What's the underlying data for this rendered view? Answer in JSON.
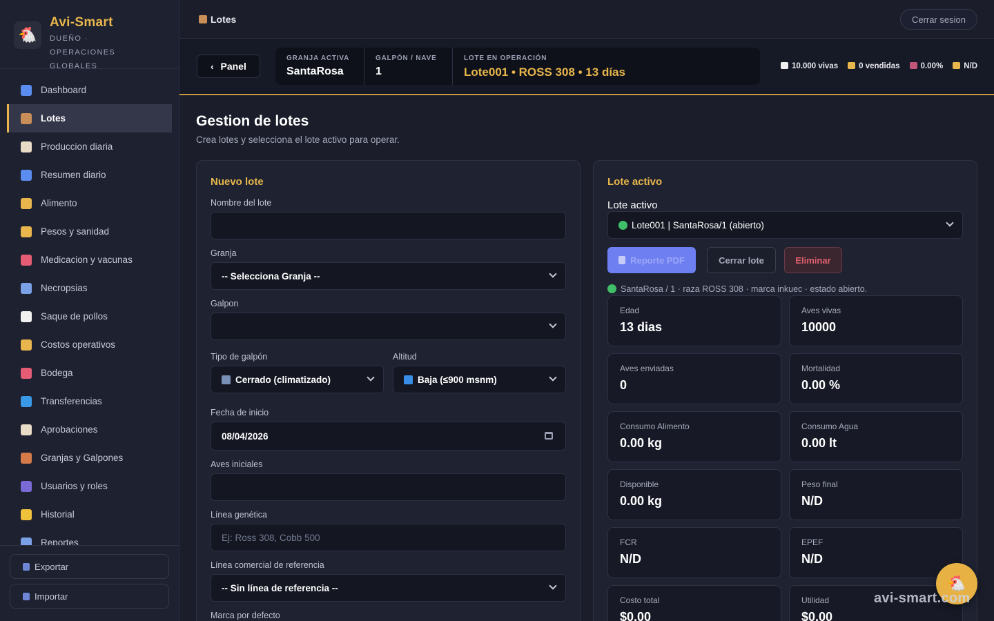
{
  "brand": {
    "name": "Avi-Smart",
    "role": "DUEÑO · OPERACIONES GLOBALES"
  },
  "nav": [
    {
      "label": "Dashboard",
      "color": "#5b8df0"
    },
    {
      "label": "Lotes",
      "color": "#c98d58"
    },
    {
      "label": "Produccion diaria",
      "color": "#e9dcc7"
    },
    {
      "label": "Resumen diario",
      "color": "#5b8df0"
    },
    {
      "label": "Alimento",
      "color": "#e8b64c"
    },
    {
      "label": "Pesos y sanidad",
      "color": "#e8b64c"
    },
    {
      "label": "Medicacion y vacunas",
      "color": "#e55c74"
    },
    {
      "label": "Necropsias",
      "color": "#7aa1e6"
    },
    {
      "label": "Saque de pollos",
      "color": "#f0f0f0"
    },
    {
      "label": "Costos operativos",
      "color": "#e8b64c"
    },
    {
      "label": "Bodega",
      "color": "#e55c74"
    },
    {
      "label": "Transferencias",
      "color": "#3a9ae8"
    },
    {
      "label": "Aprobaciones",
      "color": "#e9dcc7"
    },
    {
      "label": "Granjas y Galpones",
      "color": "#d67a4a"
    },
    {
      "label": "Usuarios y roles",
      "color": "#7a6ad6"
    },
    {
      "label": "Historial",
      "color": "#f0c23c"
    },
    {
      "label": "Reportes",
      "color": "#7aa1e6"
    }
  ],
  "footer": {
    "export": "Exportar",
    "import": "Importar"
  },
  "topbar": {
    "title": "Lotes",
    "logout": "Cerrar sesion"
  },
  "context": {
    "panel": "Panel",
    "farm_label": "GRANJA ACTIVA",
    "farm": "SantaRosa",
    "house_label": "GALPÓN / NAVE",
    "house": "1",
    "batch_label": "LOTE EN OPERACIÓN",
    "batch": "Lote001 • ROSS 308 • 13 días",
    "stats": [
      {
        "text": "10.000 vivas",
        "color": "#f0f0f0"
      },
      {
        "text": "0 vendidas",
        "color": "#e8b64c"
      },
      {
        "text": "0.00%",
        "color": "#c0567a"
      },
      {
        "text": "N/D",
        "color": "#e8b64c"
      }
    ]
  },
  "page": {
    "title": "Gestion de lotes",
    "subtitle": "Crea lotes y selecciona el lote activo para operar."
  },
  "form": {
    "title": "Nuevo lote",
    "name_label": "Nombre del lote",
    "name_value": "",
    "farm_label": "Granja",
    "farm_value": "-- Selecciona Granja --",
    "house_label": "Galpon",
    "house_value": "",
    "type_label": "Tipo de galpón",
    "type_value": "Cerrado (climatizado)",
    "altitude_label": "Altitud",
    "altitude_value": "Baja (≤900 msnm)",
    "date_label": "Fecha de inicio",
    "date_value": "08/04/2026",
    "birds_label": "Aves iniciales",
    "birds_value": "",
    "genetic_label": "Línea genética",
    "genetic_placeholder": "Ej: Ross 308, Cobb 500",
    "commercial_label": "Línea comercial de referencia",
    "commercial_value": "-- Sin línea de referencia --",
    "brand_label": "Marca por defecto"
  },
  "active": {
    "title": "Lote activo",
    "select_label": "Lote activo",
    "select_value": "Lote001 | SantaRosa/1 (abierto)",
    "btn_pdf": "Reporte PDF",
    "btn_close": "Cerrar lote",
    "btn_delete": "Eliminar",
    "meta": "SantaRosa / 1 · raza ROSS 308 · marca inkuec · estado abierto.",
    "stats": [
      {
        "label": "Edad",
        "value": "13 dias"
      },
      {
        "label": "Aves vivas",
        "value": "10000"
      },
      {
        "label": "Aves enviadas",
        "value": "0"
      },
      {
        "label": "Mortalidad",
        "value": "0.00 %"
      },
      {
        "label": "Consumo Alimento",
        "value": "0.00 kg"
      },
      {
        "label": "Consumo Agua",
        "value": "0.00 lt"
      },
      {
        "label": "Disponible",
        "value": "0.00 kg"
      },
      {
        "label": "Peso final",
        "value": "N/D"
      },
      {
        "label": "FCR",
        "value": "N/D"
      },
      {
        "label": "EPEF",
        "value": "N/D"
      },
      {
        "label": "Costo total",
        "value": "$0.00"
      },
      {
        "label": "Utilidad",
        "value": "$0.00"
      }
    ]
  },
  "watermark": "avi-smart.com"
}
